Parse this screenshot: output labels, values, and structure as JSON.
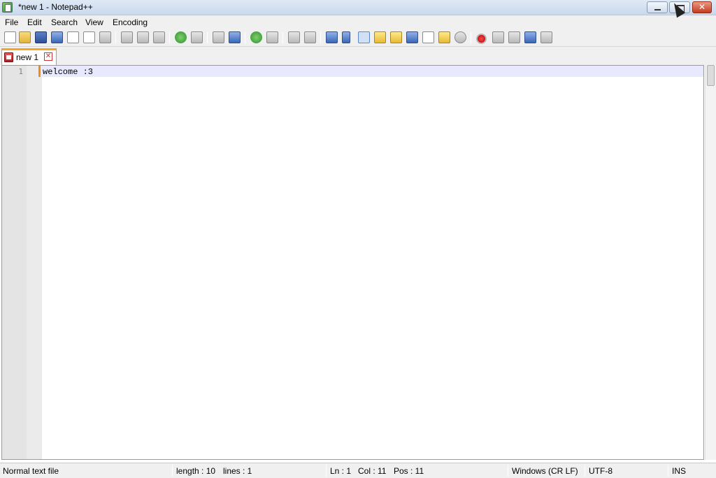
{
  "window": {
    "title": "*new 1 - Notepad++",
    "icon": "notepad-plus-plus-icon",
    "controls": {
      "minimize": "minimize-icon",
      "restore": "restore-icon",
      "close": "close-icon"
    }
  },
  "menu": {
    "items": [
      "File",
      "Edit",
      "Search",
      "View",
      "Encoding"
    ]
  },
  "toolbar": {
    "icons": [
      "new-file-icon",
      "open-file-icon",
      "save-icon",
      "save-all-icon",
      "close-icon",
      "close-all-icon",
      "print-icon",
      "cut-icon",
      "copy-icon",
      "paste-icon",
      "undo-icon",
      "redo-icon",
      "find-icon",
      "replace-icon",
      "zoom-in-icon",
      "zoom-out-icon",
      "sync-vertical-icon",
      "sync-horizontal-icon",
      "word-wrap-icon",
      "show-all-characters-icon",
      "indent-guide-icon",
      "user-language-icon",
      "doc-map-icon",
      "function-list-icon",
      "folder-as-workspace-icon",
      "monitoring-icon",
      "record-macro-icon",
      "stop-recording-icon",
      "play-macro-icon",
      "run-macro-multiple-icon",
      "save-macro-icon"
    ]
  },
  "tabs": [
    {
      "label": "new 1",
      "modified": true,
      "active": true,
      "close": "close-tab-icon"
    }
  ],
  "editor": {
    "lines": [
      {
        "number": "1",
        "text": "welcome :3"
      }
    ]
  },
  "status": {
    "file_type": "Normal text file",
    "length": "length : 10",
    "lines": "lines : 1",
    "ln": "Ln : 1",
    "col": "Col : 11",
    "pos": "Pos : 11",
    "eol": "Windows (CR LF)",
    "encoding": "UTF-8",
    "mode": "INS"
  },
  "colors": {
    "current_line": "#e8e8ff",
    "modified_marker": "#f38b1c",
    "tab_accent": "#f5a623"
  }
}
